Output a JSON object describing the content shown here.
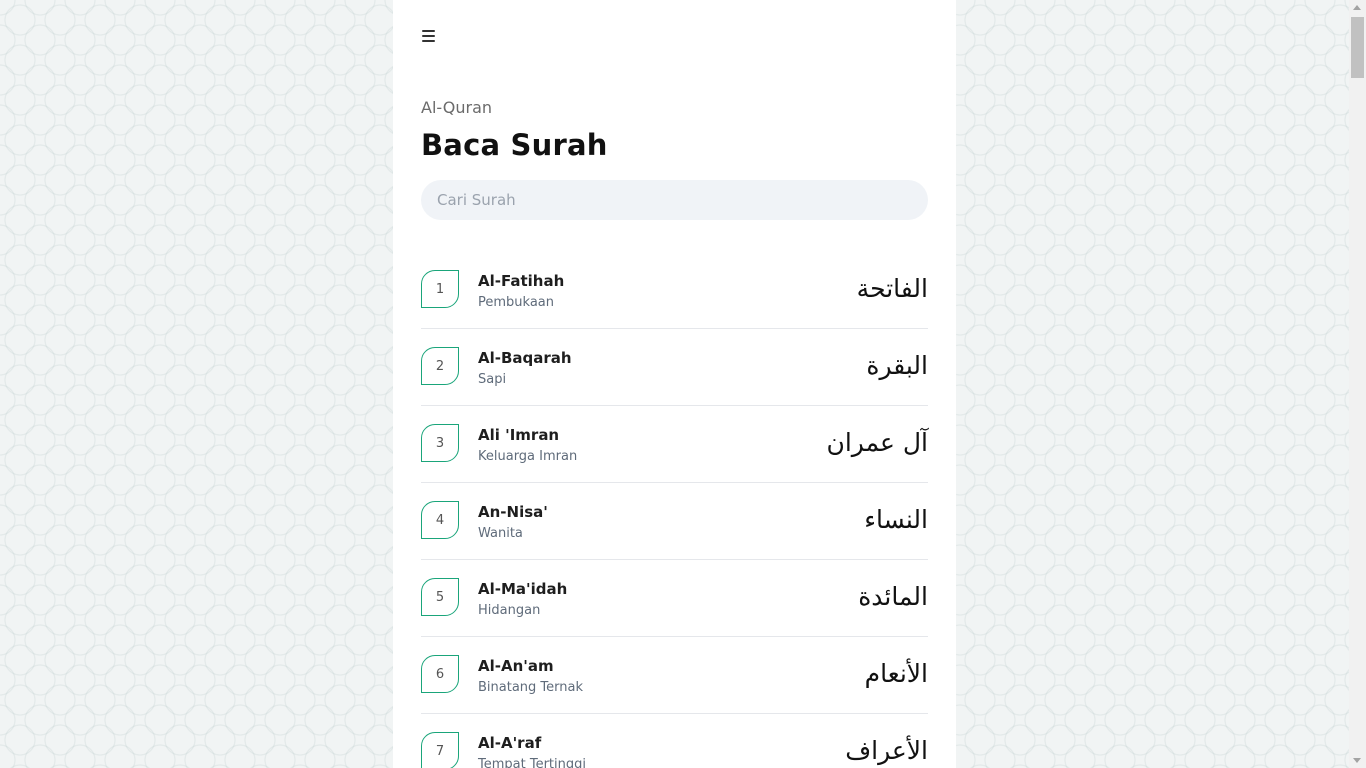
{
  "header": {
    "menu_icon": "hamburger-menu-icon",
    "subtitle": "Al-Quran",
    "title": "Baca Surah"
  },
  "search": {
    "placeholder": "Cari Surah",
    "value": ""
  },
  "accent_color": "#1aa57a",
  "surahs": [
    {
      "number": "1",
      "name": "Al-Fatihah",
      "meaning": "Pembukaan",
      "arabic": "الفاتحة"
    },
    {
      "number": "2",
      "name": "Al-Baqarah",
      "meaning": "Sapi",
      "arabic": "البقرة"
    },
    {
      "number": "3",
      "name": "Ali 'Imran",
      "meaning": "Keluarga Imran",
      "arabic": "آل عمران"
    },
    {
      "number": "4",
      "name": "An-Nisa'",
      "meaning": "Wanita",
      "arabic": "النساء"
    },
    {
      "number": "5",
      "name": "Al-Ma'idah",
      "meaning": "Hidangan",
      "arabic": "المائدة"
    },
    {
      "number": "6",
      "name": "Al-An'am",
      "meaning": "Binatang Ternak",
      "arabic": "الأنعام"
    },
    {
      "number": "7",
      "name": "Al-A'raf",
      "meaning": "Tempat Tertinggi",
      "arabic": "الأعراف"
    }
  ]
}
